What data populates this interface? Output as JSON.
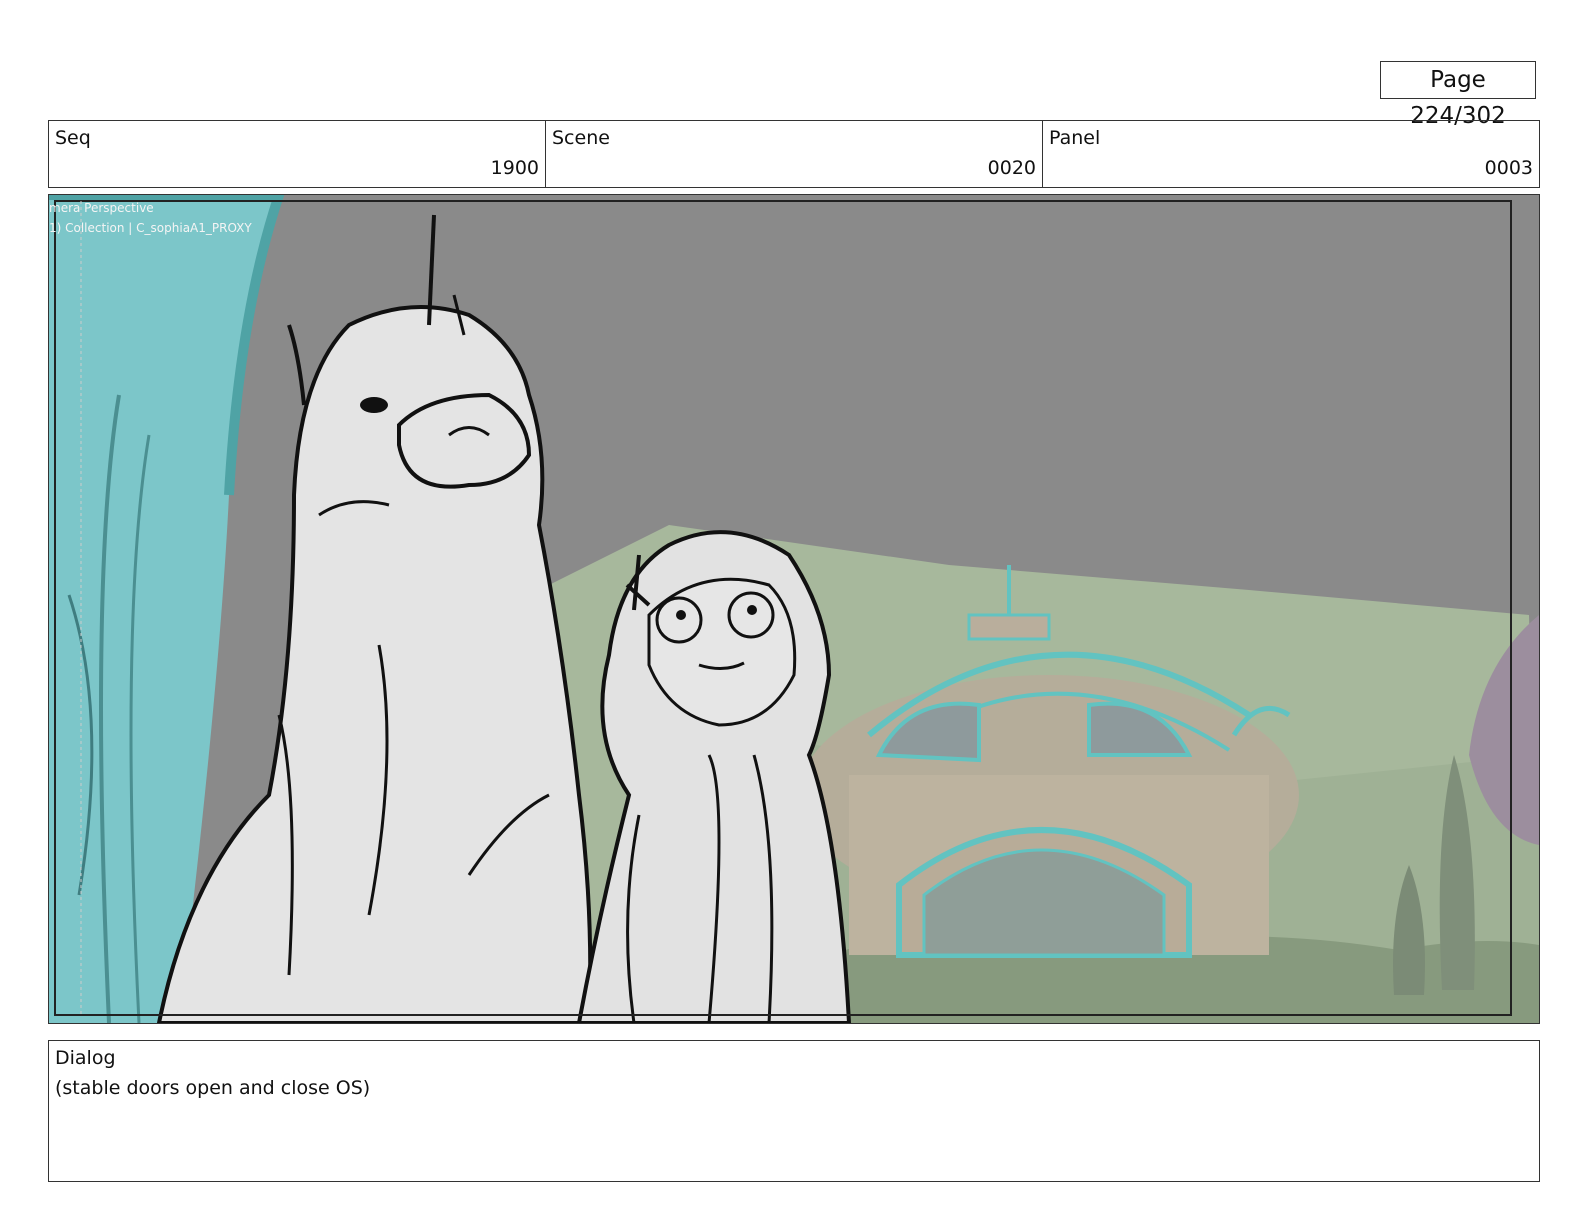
{
  "page_label": "Page 224/302",
  "fields": {
    "seq": {
      "label": "Seq",
      "value": "1900"
    },
    "scene": {
      "label": "Scene",
      "value": "0020"
    },
    "panel": {
      "label": "Panel",
      "value": "0003"
    }
  },
  "viewport_overlay": {
    "line1": "mera Perspective",
    "line2": "1) Collection | C_sophiaA1_PROXY"
  },
  "dialog": {
    "label": "Dialog",
    "text": "(stable doors open and close OS)"
  }
}
